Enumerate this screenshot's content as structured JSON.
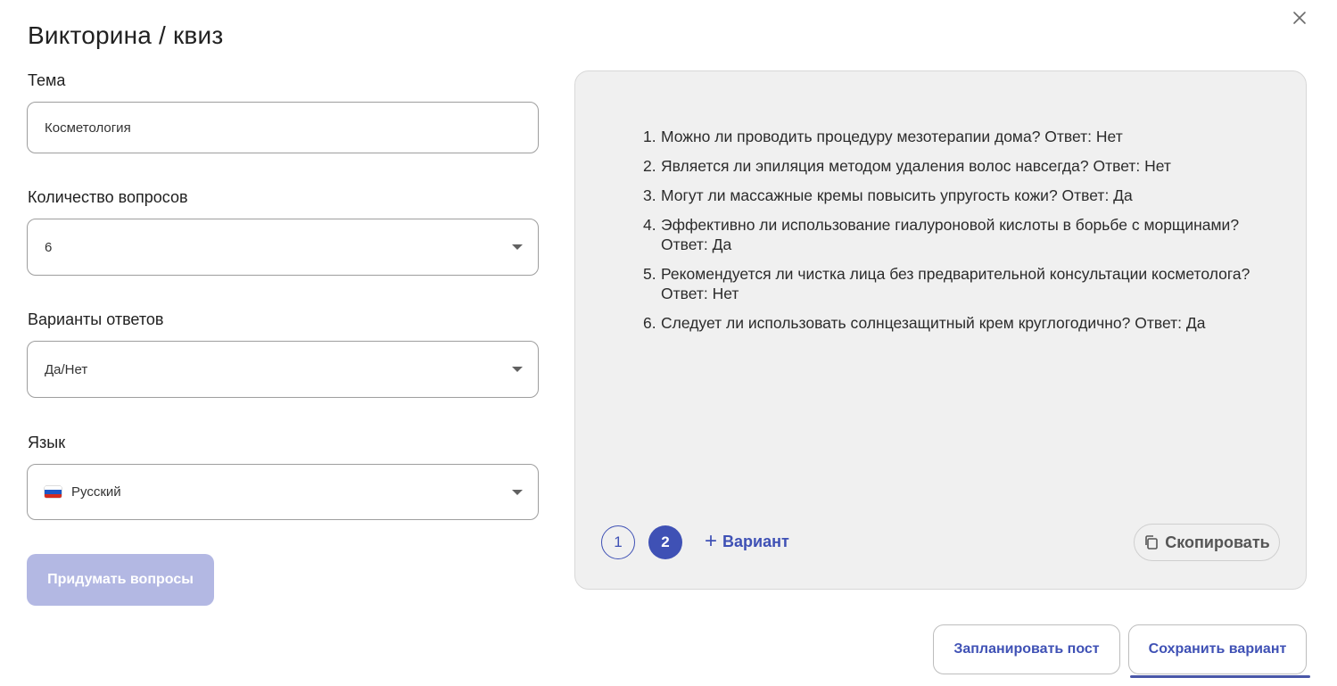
{
  "dialog": {
    "title": "Викторина / квиз",
    "close_icon": "close-icon"
  },
  "form": {
    "topic": {
      "label": "Тема",
      "value": "Косметология"
    },
    "question_count": {
      "label": "Количество вопросов",
      "value": "6"
    },
    "answer_options": {
      "label": "Варианты ответов",
      "value": "Да/Нет"
    },
    "language": {
      "label": "Язык",
      "value": "Русский",
      "flag_icon": "russia-flag-icon"
    },
    "generate_button": "Придумать вопросы",
    "generate_button_color": "#b3b8e3"
  },
  "result": {
    "questions": [
      {
        "num": "1.",
        "text": "Можно ли проводить процедуру мезотерапии дома? Ответ: Нет"
      },
      {
        "num": "2.",
        "text": "Является ли эпиляция методом удаления волос навсегда? Ответ: Нет"
      },
      {
        "num": "3.",
        "text": "Могут ли массажные кремы повысить упругость кожи? Ответ: Да"
      },
      {
        "num": "4.",
        "text": "Эффективно ли использование гиалуроновой кислоты в борьбе с морщинами? Ответ: Да"
      },
      {
        "num": "5.",
        "text": "Рекомендуется ли чистка лица без предварительной консультации косметолога? Ответ: Нет"
      },
      {
        "num": "6.",
        "text": "Следует ли использовать солнцезащитный крем круглогодично? Ответ: Да"
      }
    ],
    "variants": [
      "1",
      "2"
    ],
    "active_variant": "2",
    "add_variant_label": "Вариант",
    "copy_label": "Скопировать",
    "accent_color": "#3f51b5"
  },
  "footer": {
    "schedule_label": "Запланировать пост",
    "save_label": "Сохранить вариант"
  }
}
